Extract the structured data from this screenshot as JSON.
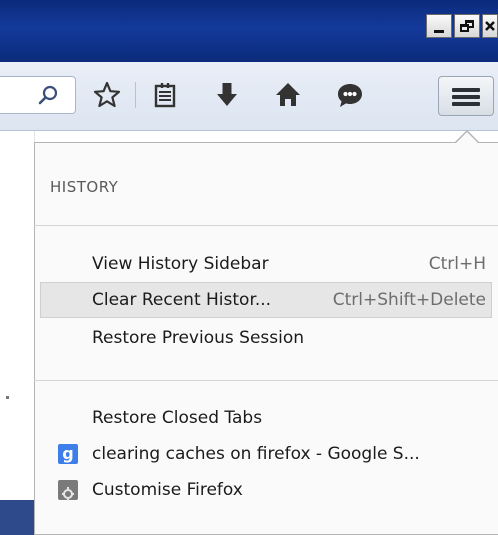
{
  "window": {
    "buttons": [
      "minimize",
      "restore",
      "close"
    ]
  },
  "toolbar": {
    "icons": [
      "search-icon",
      "bookmark-star-icon",
      "bookmarks-menu-icon",
      "downloads-icon",
      "home-icon",
      "chat-icon",
      "hamburger-menu-icon"
    ]
  },
  "panel": {
    "heading": "HISTORY",
    "items": [
      {
        "label": "View History Sidebar",
        "shortcut": "Ctrl+H"
      },
      {
        "label": "Clear Recent Histor...",
        "shortcut": "Ctrl+Shift+Delete"
      },
      {
        "label": "Restore Previous Session",
        "shortcut": ""
      }
    ],
    "items2": [
      {
        "label": "Restore Closed Tabs"
      },
      {
        "label": "clearing caches on firefox - Google S...",
        "icon": "google-favicon"
      },
      {
        "label": "Customise Firefox",
        "icon": "customize-icon"
      }
    ]
  },
  "colors": {
    "titlebar": "#133a9a",
    "toolbar": "#e3e9f4",
    "panel": "#fafafa",
    "highlight": "#e6e6e6"
  }
}
